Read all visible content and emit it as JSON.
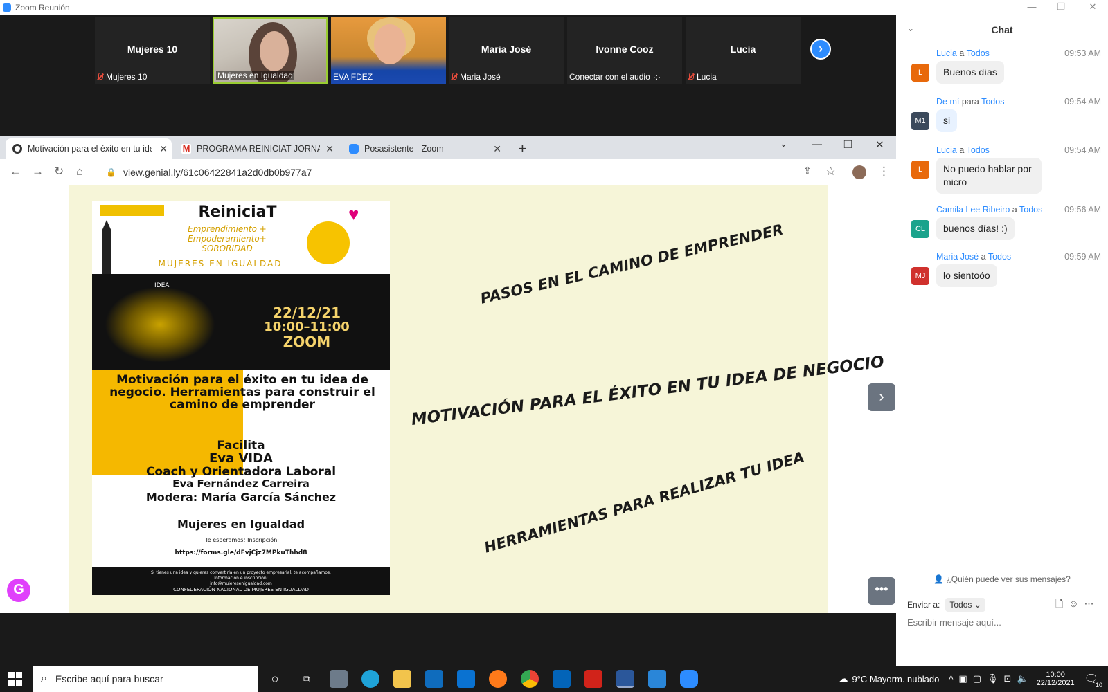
{
  "window": {
    "title": "Zoom Reunión"
  },
  "gallery": {
    "tiles": [
      {
        "name": "Mujeres 10",
        "label": "Mujeres 10",
        "muted": true,
        "video": false
      },
      {
        "name": "",
        "label": "Mujeres en Igualdad",
        "muted": false,
        "video": true
      },
      {
        "name": "",
        "label": "EVA FDEZ",
        "muted": false,
        "video": true
      },
      {
        "name": "Maria José",
        "label": "Maria José",
        "muted": true,
        "video": false
      },
      {
        "name": "Ivonne Cooz",
        "label": "Conectar con el audio",
        "muted": false,
        "video": false
      },
      {
        "name": "Lucia",
        "label": "Lucia",
        "muted": true,
        "video": false
      }
    ]
  },
  "browser": {
    "tabs": [
      {
        "title": "Motivación para el éxito en tu ide",
        "active": true
      },
      {
        "title": "PROGRAMA REINICIAT JORNADA",
        "active": false
      },
      {
        "title": "Posasistente - Zoom",
        "active": false
      }
    ],
    "url": "view.genial.ly/61c06422841a2d0db0b977a7"
  },
  "poster": {
    "title": "ReiniciaT",
    "tagline1": "Emprendimiento +",
    "tagline2": "Empoderamiento+",
    "tagline3": "SORORIDAD",
    "org": "MUJERES EN IGUALDAD",
    "idea_word": "IDEA",
    "date": "22/12/21",
    "time": "10:00–11:00",
    "platform": "ZOOM",
    "headline": "Motivación para el éxito en tu idea de negocio. Herramientas para construir el camino de emprender",
    "facilita": "Facilita",
    "speaker": "Eva VIDA",
    "role": "Coach y Orientadora Laboral",
    "speaker_full": "Eva Fernández Carreira",
    "moderator": "Modera: María García Sánchez",
    "org2": "Mujeres en Igualdad",
    "invite": "¡Te esperamos! Inscripción:",
    "link": "https://forms.gle/dFvjCjz7MPkuThhd8",
    "footer1": "Si tienes una idea y quieres convertirla en un proyecto empresarial, te acompañamos.",
    "footer2": "Información e inscripción:",
    "footer3": "info@mujeresenigualdad.com",
    "footer4": "CONFEDERACIÓN NACIONAL DE MUJERES EN IGUALDAD"
  },
  "slide": {
    "text1": "PASOS EN EL CAMINO DE EMPRENDER",
    "text2": "MOTIVACIÓN  PARA EL ÉXITO EN TU IDEA DE NEGOCIO",
    "text3": "HERRAMIENTAS PARA REALIZAR TU IDEA"
  },
  "chat": {
    "title": "Chat",
    "messages": [
      {
        "from": "Lucia",
        "to": "Todos",
        "time": "09:53 AM",
        "text": "Buenos días",
        "initials": "L",
        "color": "#e8690b"
      },
      {
        "from": "De mí",
        "to": "Todos",
        "time": "09:54 AM",
        "text": "si",
        "initials": "M1",
        "color": "#3c4a5c"
      },
      {
        "from": "Lucia",
        "to": "Todos",
        "time": "09:54 AM",
        "text": "No puedo hablar por micro",
        "initials": "L",
        "color": "#e8690b"
      },
      {
        "from": "Camila Lee Ribeiro",
        "to": "Todos",
        "time": "09:56 AM",
        "text": "buenos días! :)",
        "initials": "CL",
        "color": "#1ba38c"
      },
      {
        "from": "Maria José",
        "to": "Todos",
        "time": "09:59 AM",
        "text": "lo sientoóo",
        "initials": "MJ",
        "color": "#d0312d"
      }
    ],
    "to_word": "a",
    "to_word_self": "para",
    "who_can_see": "¿Quién puede ver sus mensajes?",
    "send_to_label": "Enviar a:",
    "send_to_value": "Todos",
    "input_placeholder": "Escribir mensaje aquí..."
  },
  "taskbar": {
    "search_placeholder": "Escribe aquí para buscar",
    "weather": "9°C  Mayorm. nublado",
    "time": "10:00",
    "date": "22/12/2021",
    "notifications": "10"
  }
}
